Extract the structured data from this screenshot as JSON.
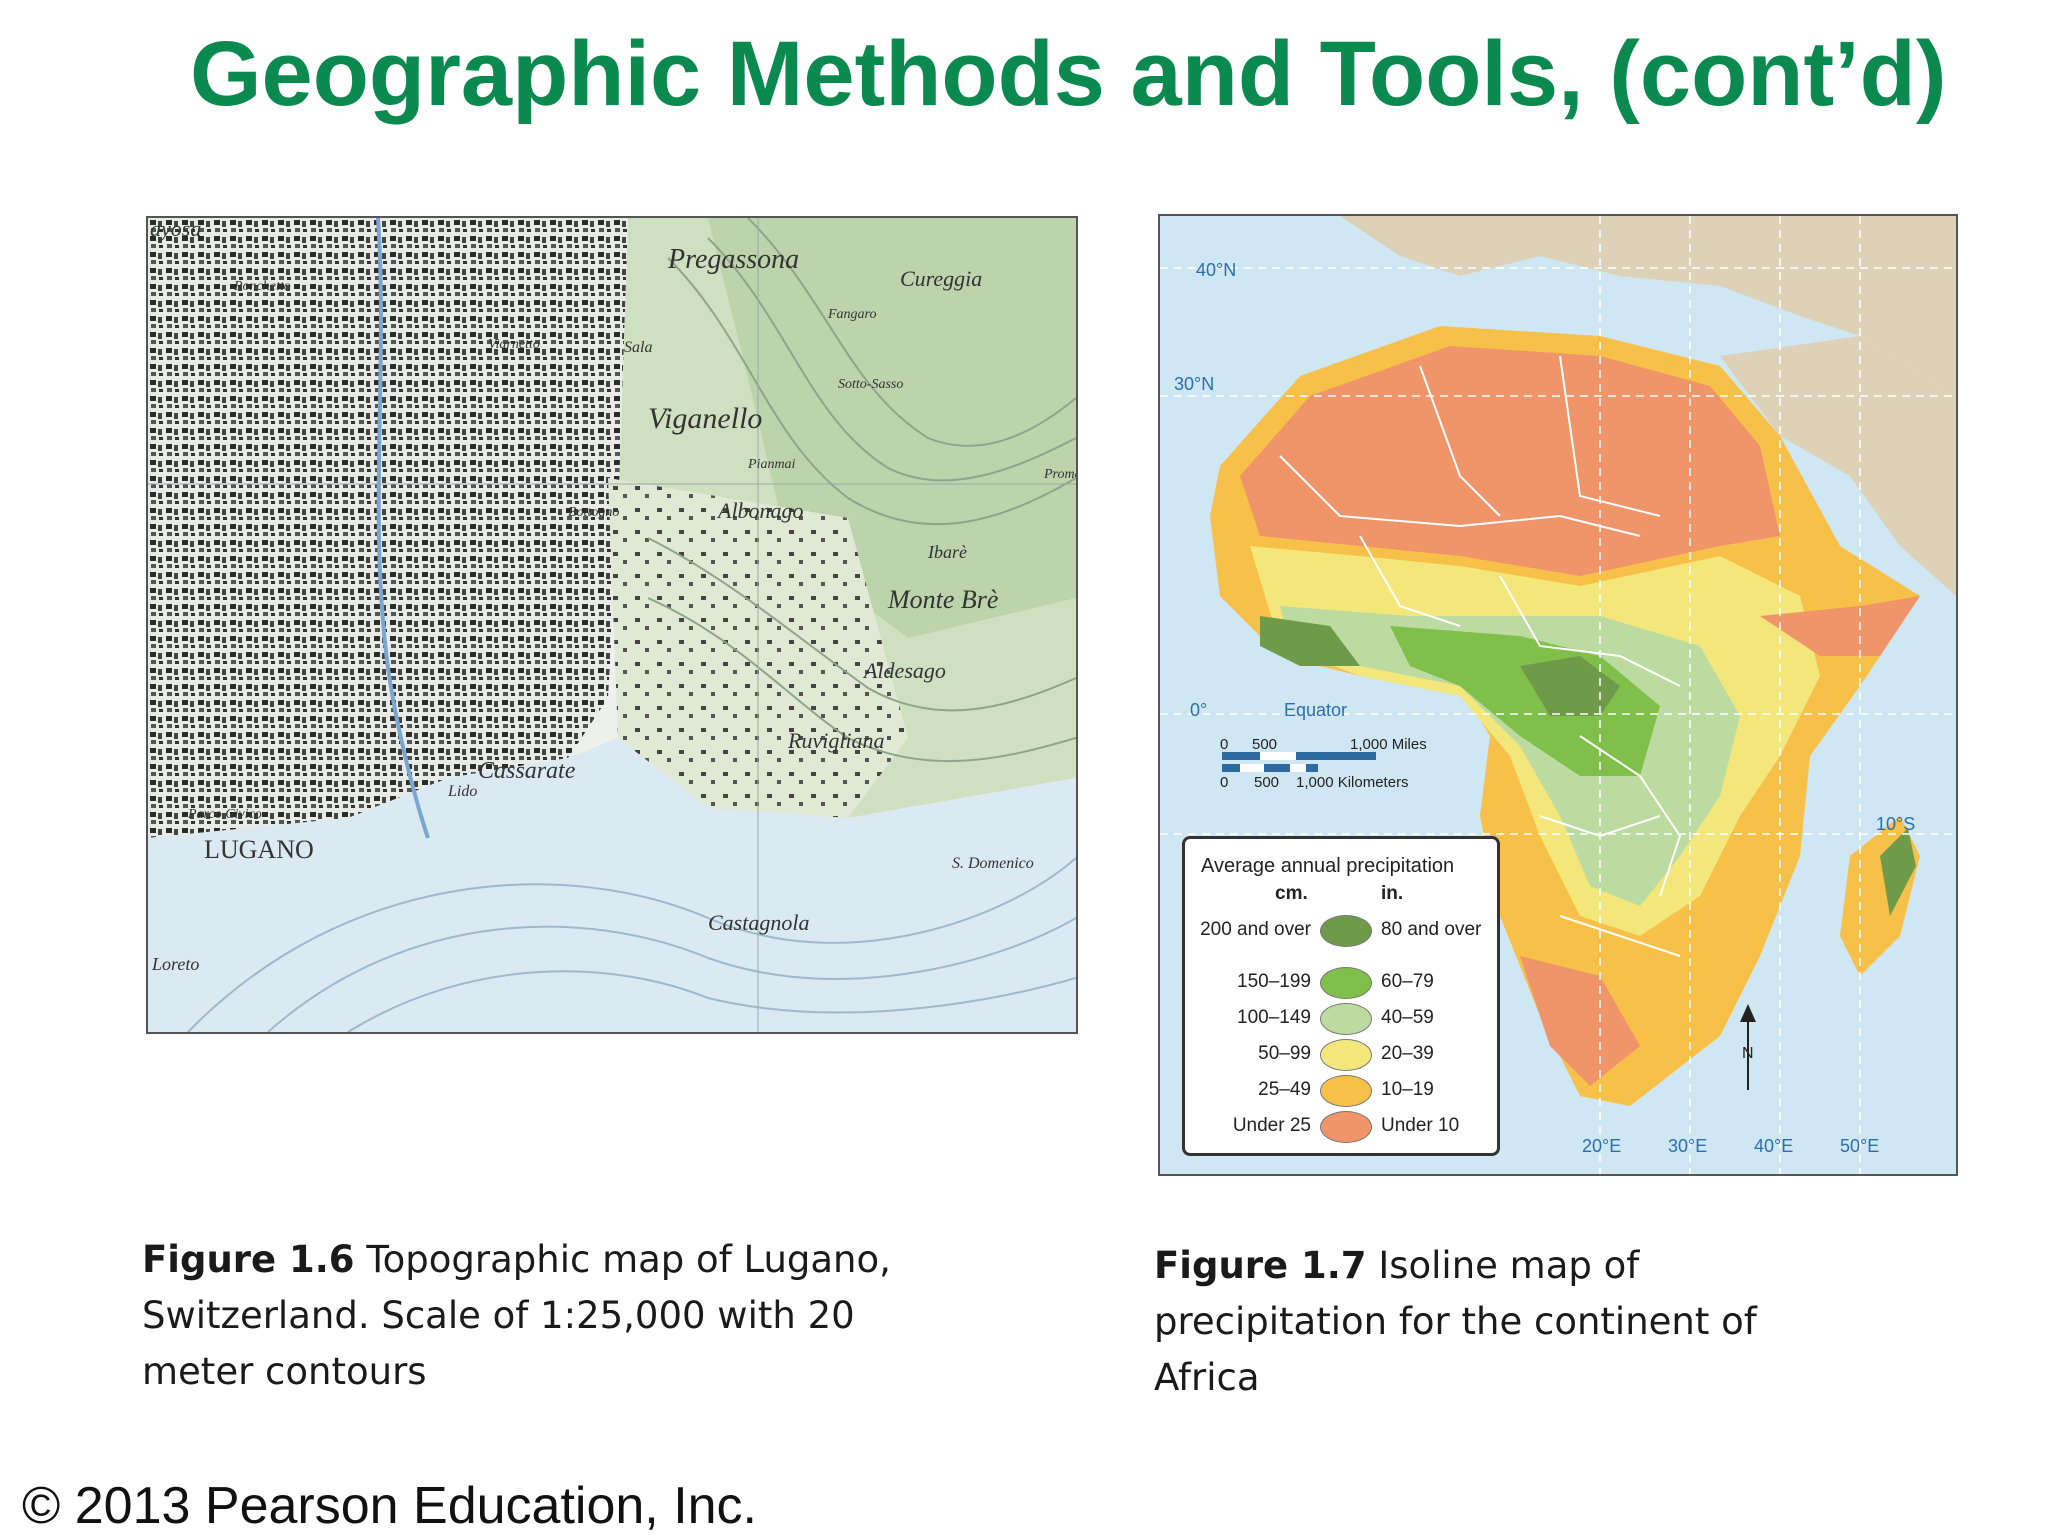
{
  "slide": {
    "title": "Geographic Methods and Tools, (cont’d)",
    "copyright": "© 2013 Pearson Education, Inc."
  },
  "figure16": {
    "caption_bold": "Figure 1.6",
    "caption_text": " Topographic map of Lugano, Switzerland. Scale of 1:25,000 with 20 meter contours",
    "place_labels": [
      "ayosa",
      "Pregassona",
      "Cureggia",
      "Viganello",
      "Albonago",
      "Monte Brè",
      "Aldesago",
      "Ruvigliana",
      "Cassarate",
      "Lido",
      "LUGANO",
      "Castagnola",
      "S. Domenico",
      "Loreto",
      "Parco Civico",
      "Viarnetto",
      "Sala",
      "Bottogno",
      "Ronchetto",
      "Pianmai",
      "Sotto-Sasso",
      "Fangaro",
      "Ibarè",
      "Prome"
    ],
    "colors": {
      "land": "#eef0ec",
      "lake": "#dbe9f3",
      "forest": "#cde0c0",
      "city": "#2a2a2a",
      "contour": "#8fa58a"
    }
  },
  "figure17": {
    "caption_bold": "Figure 1.7",
    "caption_text": " Isoline map of precipitation for the continent of Africa",
    "legend_title": "Average annual precipitation",
    "legend_cm_header": "cm.",
    "legend_in_header": "in.",
    "legend_rows": [
      {
        "cm": "200 and over",
        "in": "80 and over",
        "color": "#6f9a4a"
      },
      {
        "cm": "150–199",
        "in": "60–79",
        "color": "#7fbf4a"
      },
      {
        "cm": "100–149",
        "in": "40–59",
        "color": "#bcdba0"
      },
      {
        "cm": "50–99",
        "in": "20–39",
        "color": "#f3e67a"
      },
      {
        "cm": "25–49",
        "in": "10–19",
        "color": "#f7c048"
      },
      {
        "cm": "Under 25",
        "in": "Under 10",
        "color": "#f0946a"
      }
    ],
    "lat_labels": [
      "40°N",
      "30°N",
      "0°",
      "Equator",
      "10°S"
    ],
    "lon_labels": [
      "20°E",
      "30°E",
      "40°E",
      "50°E"
    ],
    "scale_miles": [
      "0",
      "500",
      "1,000 Miles"
    ],
    "scale_km": [
      "0",
      "500",
      "1,000 Kilometers"
    ],
    "north_label": "N",
    "colors": {
      "ocean": "#cfe6f3",
      "land_other": "#ddd2b8"
    }
  }
}
